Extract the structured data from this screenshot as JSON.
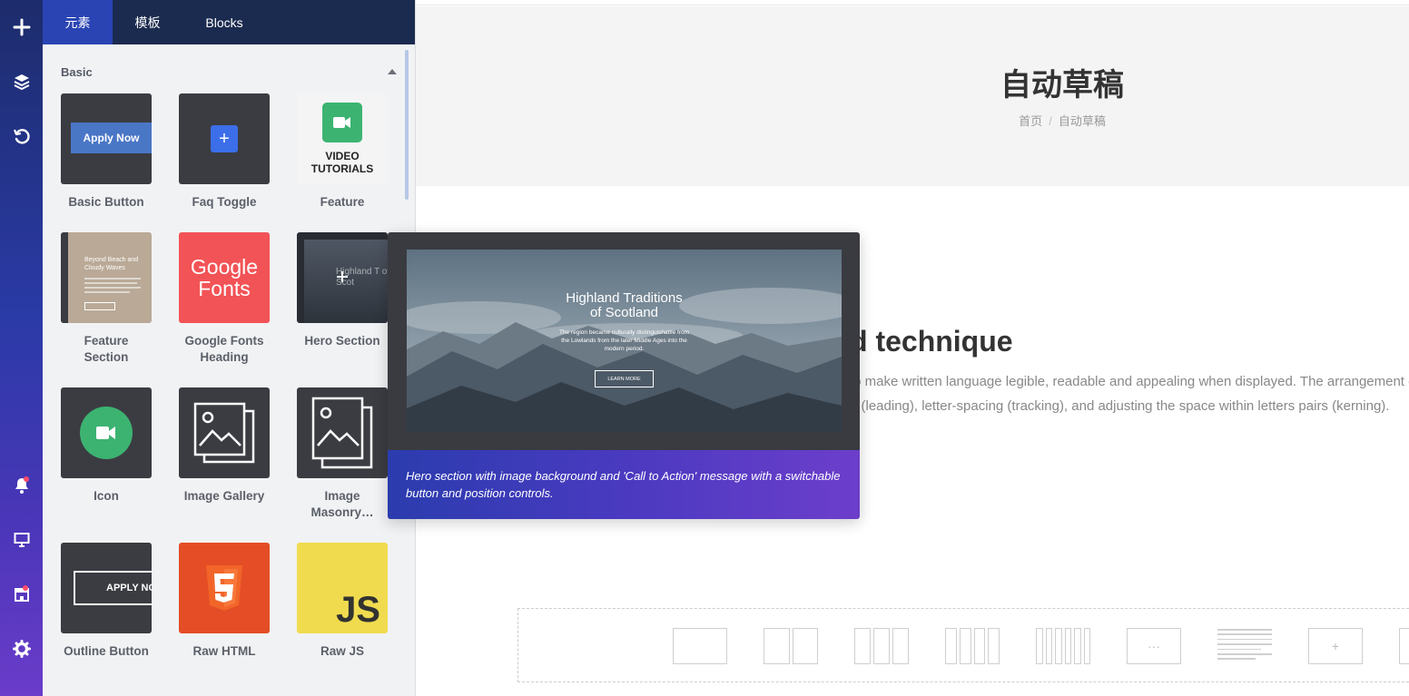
{
  "rail": {
    "items": [
      "add",
      "layers",
      "undo",
      "notifications",
      "desktop-preview",
      "store",
      "settings"
    ]
  },
  "panel": {
    "tabs": [
      {
        "label": "元素"
      },
      {
        "label": "模板"
      },
      {
        "label": "Blocks"
      }
    ],
    "section_title": "Basic",
    "elements": [
      {
        "label": "Basic Button",
        "thumb_text": "Apply Now"
      },
      {
        "label": "Faq Toggle",
        "thumb_text": "+"
      },
      {
        "label": "Feature",
        "thumb_text_1": "VIDEO",
        "thumb_text_2": "TUTORIALS"
      },
      {
        "label": "Feature Section",
        "thumb_title": "Beyond Beach and Cloudy Waves"
      },
      {
        "label": "Google Fonts Heading",
        "thumb_text_1": "Google",
        "thumb_text_2": "Fonts"
      },
      {
        "label": "Hero Section",
        "thumb_text": "Highland T of Scot"
      },
      {
        "label": "Icon"
      },
      {
        "label": "Image Gallery"
      },
      {
        "label": "Image Masonry…"
      },
      {
        "label": "Outline Button",
        "thumb_text": "APPLY NO"
      },
      {
        "label": "Raw HTML"
      },
      {
        "label": "Raw JS",
        "thumb_text": "JS"
      }
    ]
  },
  "main": {
    "page_title": "自动草稿",
    "breadcrumb": {
      "home": "首页",
      "sep": "/",
      "current": "自动草稿"
    },
    "article_title": "d technique",
    "paragraph_line_1": "to make written language legible, readable and appealing when displayed. The arrangement of type involves selecting typefaces",
    "paragraph_line_2": "g (leading), letter-spacing (tracking), and adjusting the space within letters pairs (kerning)."
  },
  "popover": {
    "preview_title_1": "Highland Traditions",
    "preview_title_2": "of Scotland",
    "preview_sub_1": "The region became culturally distinguishable from",
    "preview_sub_2": "the Lowlands from the later Middle Ages into the",
    "preview_sub_3": "modern period.",
    "preview_button": "LEARN MORE",
    "description": "Hero section with image background and 'Call to Action' message with a switchable button and position controls."
  },
  "colors": {
    "rail_top": "#1d2c6b",
    "rail_bottom": "#6a3cc9",
    "tab_bar": "#1b2b4f",
    "tab_active": "#2a44b4",
    "notification_dot": "#ff4d6d"
  }
}
